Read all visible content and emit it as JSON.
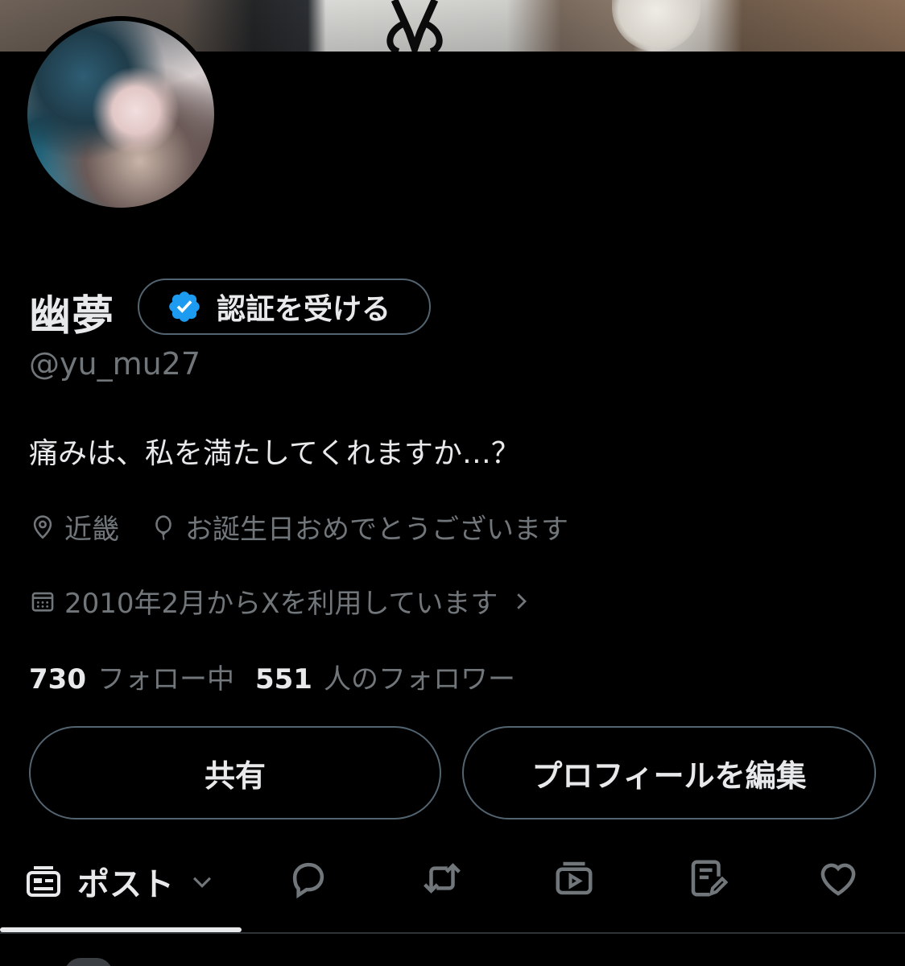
{
  "profile": {
    "display_name": "幽夢",
    "handle": "@yu_mu27",
    "bio": "痛みは、私を満たしてくれますか…？",
    "location": "近畿",
    "birthday_text": "お誕生日おめでとうございます",
    "joined": "2010年2月からXを利用しています",
    "following_count": "730",
    "following_label": "フォロー中",
    "followers_count": "551",
    "followers_label": "人のフォロワー"
  },
  "verify": {
    "label": "認証を受ける"
  },
  "actions": {
    "share_label": "共有",
    "edit_label": "プロフィールを編集"
  },
  "tabs": {
    "selected_label": "ポスト",
    "icons": [
      "post-icon",
      "reply-icon",
      "repost-icon",
      "media-icon",
      "articles-icon",
      "likes-icon"
    ]
  },
  "colors": {
    "background": "#000000",
    "text_primary": "#e7e9ea",
    "text_secondary": "#71767b",
    "border": "#536471",
    "verified_blue": "#1d9bf0"
  }
}
